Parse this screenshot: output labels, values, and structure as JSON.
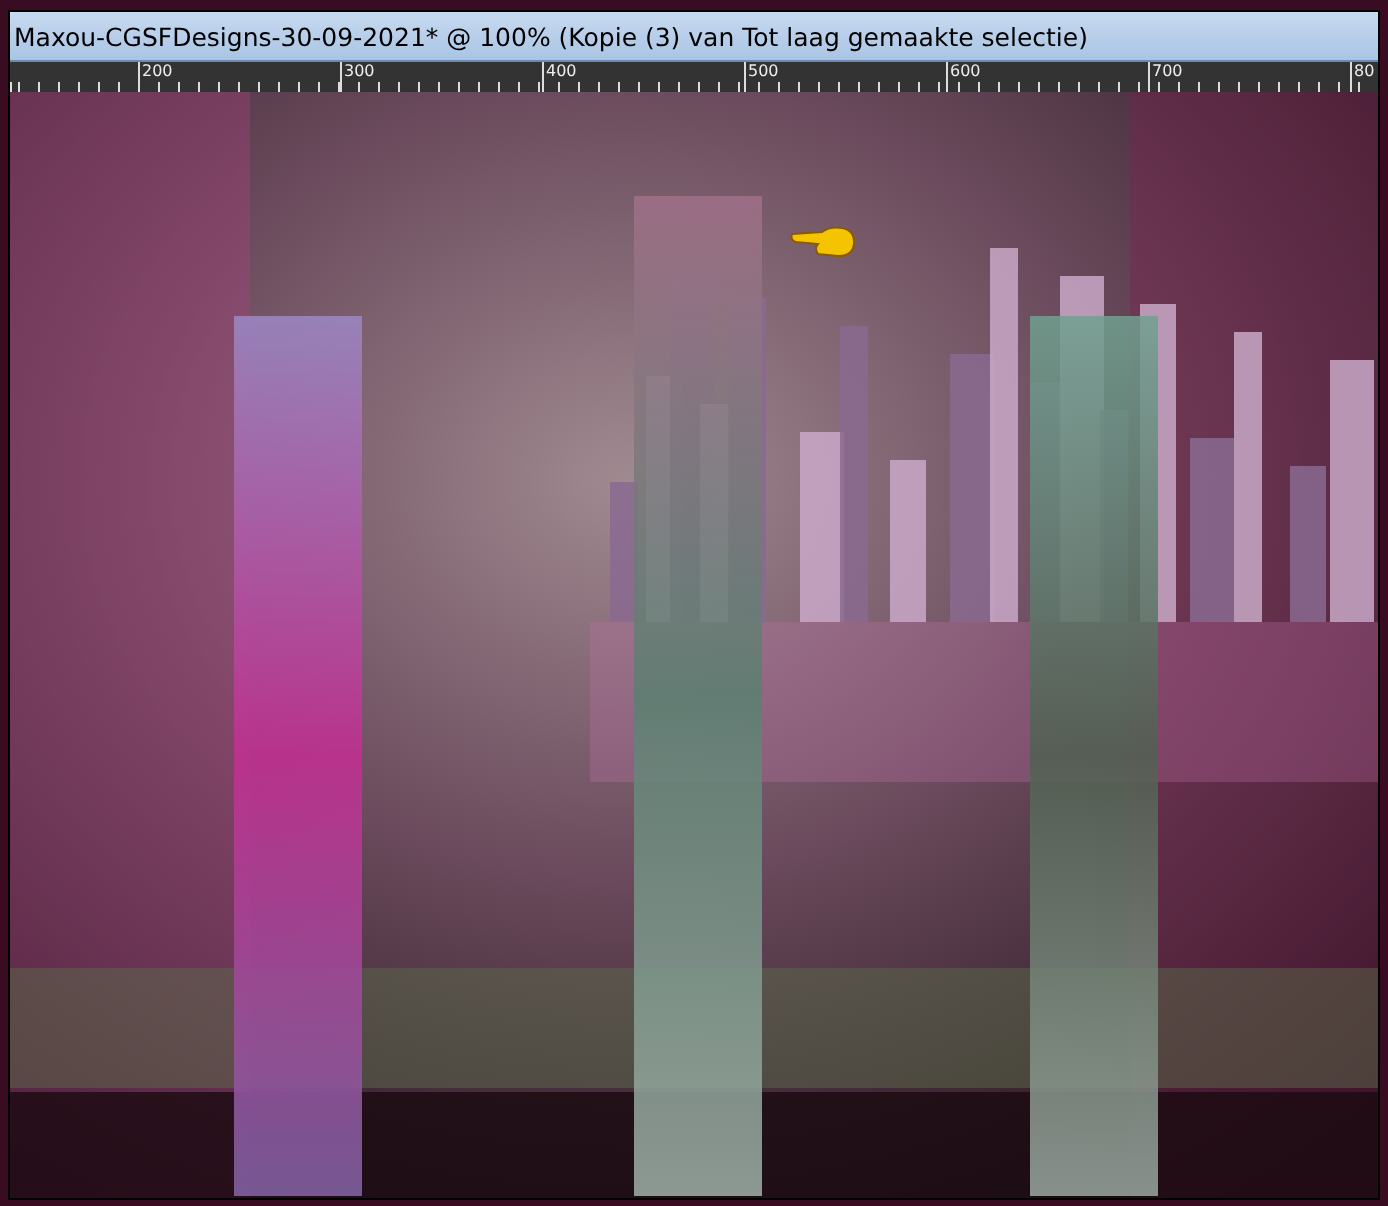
{
  "window": {
    "title": "Maxou-CGSFDesigns-30-09-2021* @ 100% (Kopie (3) van Tot laag gemaakte selectie)"
  },
  "ruler": {
    "labels": [
      "200",
      "300",
      "400",
      "500",
      "600",
      "700",
      "80"
    ]
  }
}
